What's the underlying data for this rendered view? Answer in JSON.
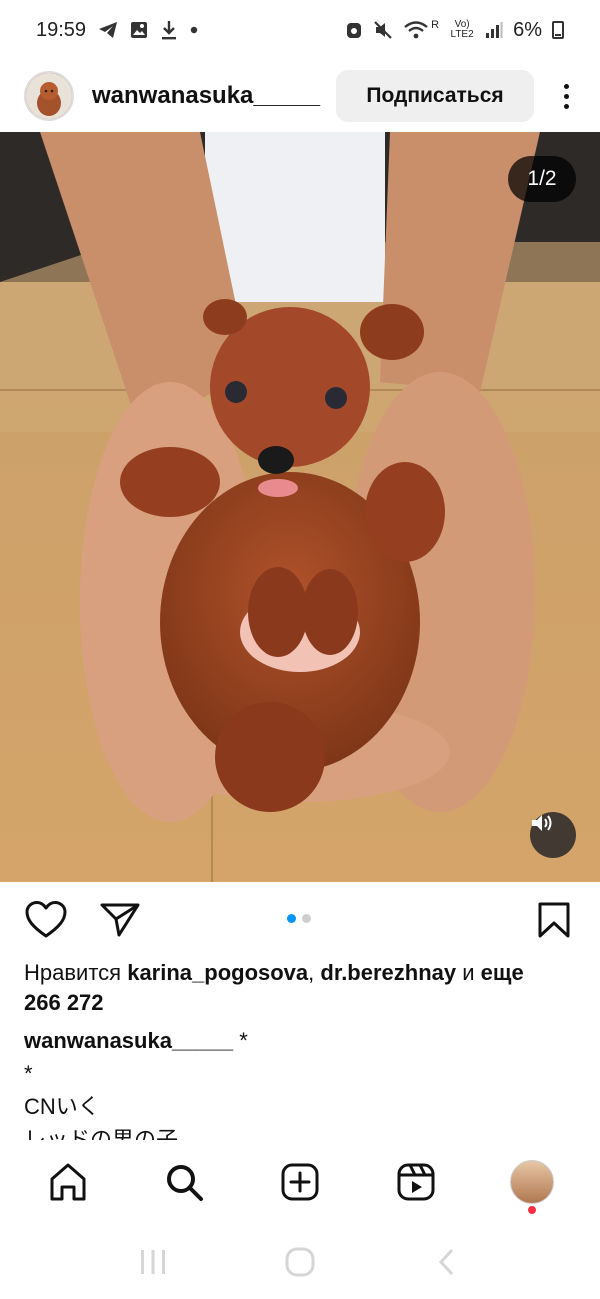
{
  "status_bar": {
    "time": "19:59",
    "battery": "6%",
    "network_label": "Vo) LTE2",
    "r_label": "R"
  },
  "post": {
    "username": "wanwanasuka_____",
    "follow_label": "Подписаться",
    "image_counter": "1/2",
    "image_description_icon": "puppy-photo"
  },
  "likes": {
    "prefix": "Нравится",
    "user1": "karina_pogosova",
    "separator": ",",
    "user2": "dr.berezhnay",
    "and": "и",
    "more_label": "еще",
    "count": "266 272"
  },
  "caption": {
    "username": "wanwanasuka_____",
    "line1_rest": " *",
    "line2": "*",
    "line3": "CNいく",
    "line4": "レッドの男の子"
  },
  "colors": {
    "accent": "#0095f6",
    "notif": "#ff3040",
    "follow_bg": "#efefef"
  },
  "nav": {
    "items": [
      "home-icon",
      "search-icon",
      "create-icon",
      "reels-icon",
      "profile-avatar"
    ]
  }
}
